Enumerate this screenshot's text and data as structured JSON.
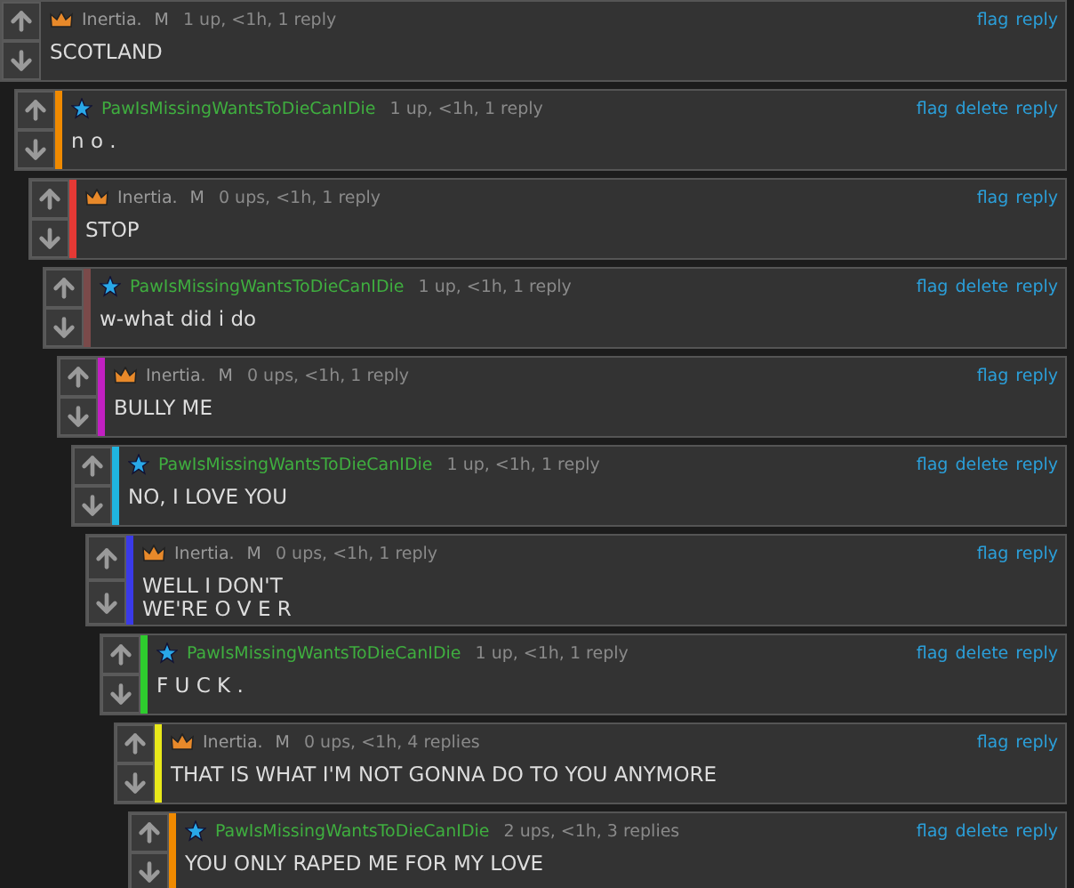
{
  "thread": [
    {
      "kind": "crown",
      "user": "Inertia.",
      "flair": "M",
      "meta": "1 up, <1h, 1 reply",
      "links": [
        "flag",
        "reply"
      ],
      "body": [
        "SCOTLAND"
      ],
      "children": [
        {
          "kind": "star",
          "user": "PawIsMissingWantsToDieCanIDie",
          "meta": "1 up, <1h, 1 reply",
          "links": [
            "flag",
            "delete",
            "reply"
          ],
          "body": [
            "n o ."
          ],
          "color": "#f08a00",
          "children": [
            {
              "kind": "crown",
              "user": "Inertia.",
              "flair": "M",
              "meta": "0 ups, <1h, 1 reply",
              "links": [
                "flag",
                "reply"
              ],
              "body": [
                "STOP"
              ],
              "color": "#e53935",
              "children": [
                {
                  "kind": "star",
                  "user": "PawIsMissingWantsToDieCanIDie",
                  "meta": "1 up, <1h, 1 reply",
                  "links": [
                    "flag",
                    "delete",
                    "reply"
                  ],
                  "body": [
                    "w-what did i do"
                  ],
                  "color": "#7a4a4a",
                  "children": [
                    {
                      "kind": "crown",
                      "user": "Inertia.",
                      "flair": "M",
                      "meta": "0 ups, <1h, 1 reply",
                      "links": [
                        "flag",
                        "reply"
                      ],
                      "body": [
                        "BULLY ME"
                      ],
                      "color": "#c21fc2",
                      "children": [
                        {
                          "kind": "star",
                          "user": "PawIsMissingWantsToDieCanIDie",
                          "meta": "1 up, <1h, 1 reply",
                          "links": [
                            "flag",
                            "delete",
                            "reply"
                          ],
                          "body": [
                            "NO, I LOVE YOU"
                          ],
                          "color": "#1fb5e0",
                          "children": [
                            {
                              "kind": "crown",
                              "user": "Inertia.",
                              "flair": "M",
                              "meta": "0 ups, <1h, 1 reply",
                              "links": [
                                "flag",
                                "reply"
                              ],
                              "body": [
                                "WELL I DON'T",
                                "WE'RE O V E R"
                              ],
                              "color": "#3a3ae8",
                              "children": [
                                {
                                  "kind": "star",
                                  "user": "PawIsMissingWantsToDieCanIDie",
                                  "meta": "1 up, <1h, 1 reply",
                                  "links": [
                                    "flag",
                                    "delete",
                                    "reply"
                                  ],
                                  "body": [
                                    "F U C K ."
                                  ],
                                  "color": "#2ecc2e",
                                  "children": [
                                    {
                                      "kind": "crown",
                                      "user": "Inertia.",
                                      "flair": "M",
                                      "meta": "0 ups, <1h, 4 replies",
                                      "links": [
                                        "flag",
                                        "reply"
                                      ],
                                      "body": [
                                        "THAT IS WHAT I'M NOT GONNA DO TO YOU ANYMORE"
                                      ],
                                      "color": "#e8e81a",
                                      "children": [
                                        {
                                          "kind": "star",
                                          "user": "PawIsMissingWantsToDieCanIDie",
                                          "meta": "2 ups, <1h, 3 replies",
                                          "links": [
                                            "flag",
                                            "delete",
                                            "reply"
                                          ],
                                          "body": [
                                            "YOU ONLY RAPED ME FOR MY LOVE"
                                          ],
                                          "color": "#f08a00"
                                        }
                                      ]
                                    }
                                  ]
                                }
                              ]
                            }
                          ]
                        }
                      ]
                    }
                  ]
                }
              ]
            }
          ]
        }
      ]
    }
  ]
}
